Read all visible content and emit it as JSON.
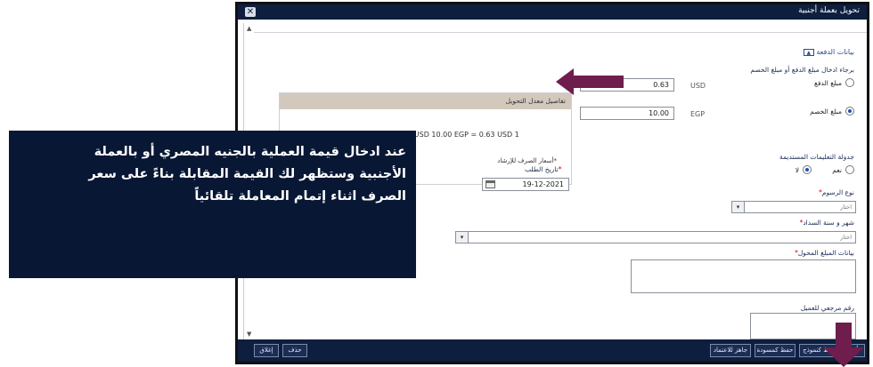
{
  "window": {
    "title": "تحويل بعملة أجنبية",
    "close_icon": "close-icon"
  },
  "section": {
    "title": "بيانات الدفعة",
    "collapse_symbol": "▲"
  },
  "payment": {
    "prompt": "برجاء ادخال مبلغ الدفع أو مبلغ الخصم",
    "pay_label": "مبلغ الدفع",
    "pay_value": "0.63",
    "pay_currency": "USD",
    "discount_label": "مبلغ الخصم",
    "discount_value": "10.00",
    "discount_currency": "EGP",
    "selected": "discount"
  },
  "rate_panel": {
    "header": "تفاصيل معدل التحويل",
    "line": "EGP = 0.06345178 USD  10.00 EGP = 0.63 USD 1",
    "note": "*أسعار الصرف للإرشاد"
  },
  "schedule": {
    "label": "جدولة التعليمات المستديمة",
    "yes": "نعم",
    "no": "لا",
    "selected": "no"
  },
  "request_date": {
    "label": "تاريخ الطلب",
    "value": "19-12-2021"
  },
  "fees": {
    "label": "نوع الرسوم",
    "placeholder": "اختار"
  },
  "month": {
    "label": "شهر و سنة السداد",
    "placeholder": "اختار"
  },
  "transfer_details": {
    "label": "بيانات المبلغ المحول"
  },
  "reference": {
    "label": "رقم مرجعي للعميل"
  },
  "required_mark": "*",
  "footer": {
    "buttons": [
      "تأكيد",
      "حفظ كنموذج",
      "حفظ كمسودة",
      "جاهز للاعتماد"
    ],
    "delete": "حذف",
    "close": "إغلاق"
  },
  "overlay": {
    "text": "عند ادخال قيمة العملية بالجنيه المصري أو بالعملة الأجنبية وستظهر لك القيمة المقابلة بناءً على سعر الصرف اثناء إتمام المعاملة تلقائياً"
  },
  "colors": {
    "titlebar": "#0d1e3f",
    "arrow": "#6e1d4d",
    "overlay": "#081734"
  }
}
